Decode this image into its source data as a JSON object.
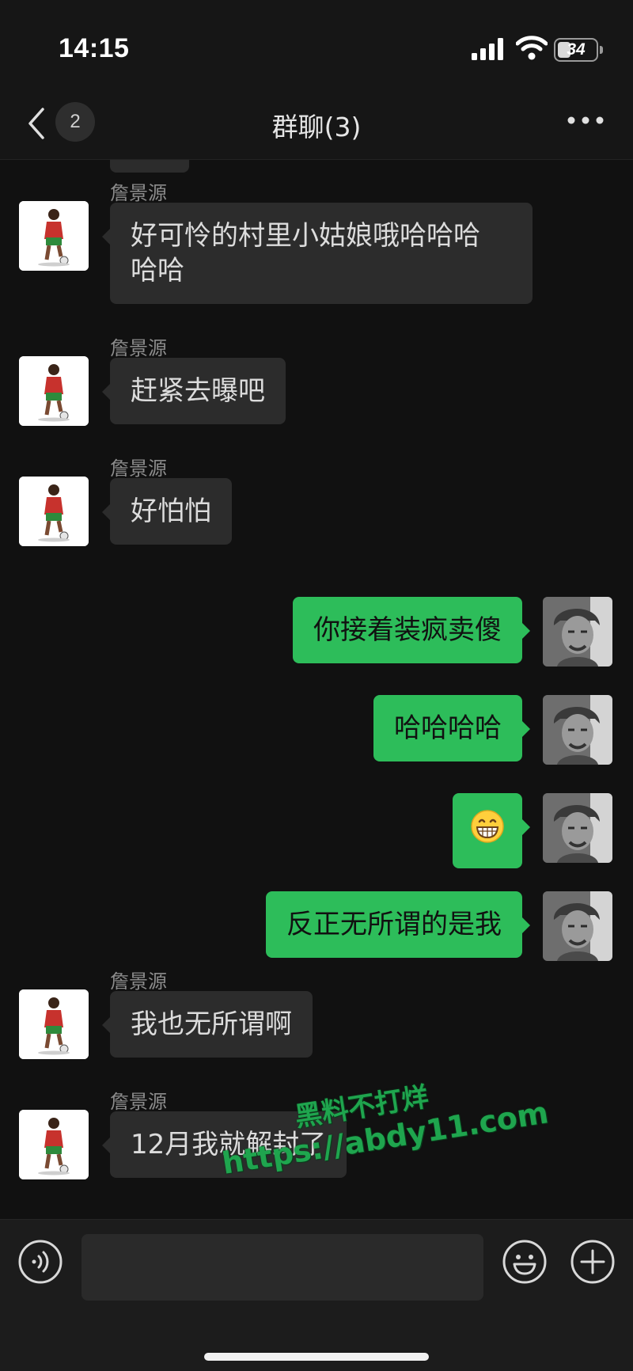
{
  "status_bar": {
    "time": "14:15",
    "battery": "34",
    "battery_fill": 0.34
  },
  "nav": {
    "unread_count": "2",
    "title": "群聊(3)"
  },
  "colors": {
    "background": "#111111",
    "incoming_bubble": "#2c2c2c",
    "outgoing_bubble": "#2dbd5a",
    "watermark": "#1fa54e"
  },
  "messages": [
    {
      "direction": "in",
      "sender": "詹景源",
      "lines": [
        "好可怜的村里小姑娘哦哈哈哈",
        "哈哈"
      ]
    },
    {
      "direction": "in",
      "sender": "詹景源",
      "lines": [
        "赶紧去曝吧"
      ]
    },
    {
      "direction": "in",
      "sender": "詹景源",
      "lines": [
        "好怕怕"
      ]
    },
    {
      "direction": "out",
      "lines": [
        "你接着装疯卖傻"
      ]
    },
    {
      "direction": "out",
      "lines": [
        "哈哈哈哈"
      ]
    },
    {
      "direction": "out",
      "emoji": "grinning-face-icon"
    },
    {
      "direction": "out",
      "lines": [
        "反正无所谓的是我"
      ]
    },
    {
      "direction": "in",
      "sender": "詹景源",
      "lines": [
        "我也无所谓啊"
      ]
    },
    {
      "direction": "in",
      "sender": "詹景源",
      "lines": [
        "12月我就解封了"
      ]
    }
  ],
  "watermark": {
    "line1": "黑料不打烊",
    "line2": "https://abdy11.com"
  },
  "input_bar": {
    "placeholder": "",
    "icons": [
      "voice-icon",
      "emoji-icon",
      "plus-icon"
    ]
  }
}
